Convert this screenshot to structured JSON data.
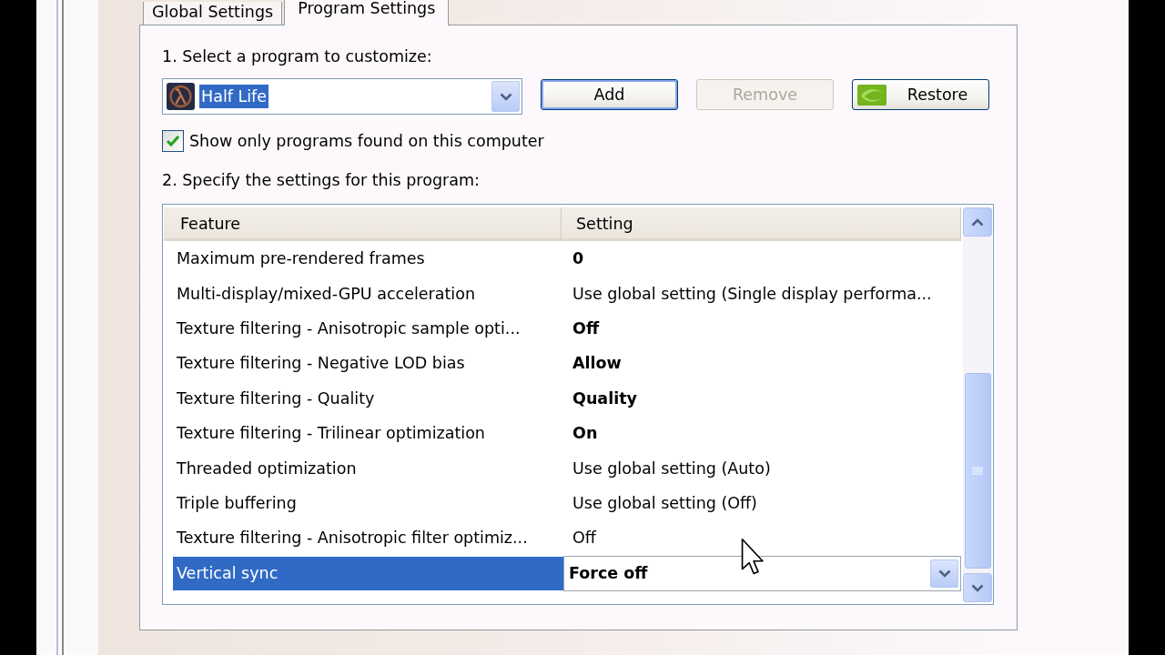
{
  "tabs": [
    {
      "label": "Global Settings",
      "selected": false
    },
    {
      "label": "Program Settings",
      "selected": true
    }
  ],
  "program_section": {
    "heading": "1. Select a program to customize:",
    "program_select": {
      "value": "Half Life",
      "focused": true
    },
    "buttons": [
      {
        "label": "Add",
        "kind": "text",
        "default": true,
        "disabled": false
      },
      {
        "label": "Remove",
        "kind": "text",
        "default": false,
        "disabled": true
      },
      {
        "label": "Restore",
        "kind": "logo",
        "default": false,
        "disabled": false
      }
    ],
    "checkbox": {
      "label": "Show only programs found on this computer",
      "checked": true
    }
  },
  "settings_section": {
    "heading": "2. Specify the settings for this program:",
    "table": {
      "columns": [
        "Feature",
        "Setting"
      ],
      "rows": [
        {
          "feature": "Maximum pre-rendered frames",
          "setting": "0",
          "overridden": true,
          "selected": false
        },
        {
          "feature": "Multi-display/mixed-GPU acceleration",
          "setting": "Use global setting (Single display performa...",
          "overridden": false,
          "selected": false
        },
        {
          "feature": "Texture filtering - Anisotropic sample opti...",
          "setting": "Off",
          "overridden": true,
          "selected": false
        },
        {
          "feature": "Texture filtering - Negative LOD bias",
          "setting": "Allow",
          "overridden": true,
          "selected": false
        },
        {
          "feature": "Texture filtering - Quality",
          "setting": "Quality",
          "overridden": true,
          "selected": false
        },
        {
          "feature": "Texture filtering - Trilinear optimization",
          "setting": "On",
          "overridden": true,
          "selected": false
        },
        {
          "feature": "Threaded optimization",
          "setting": "Use global setting (Auto)",
          "overridden": false,
          "selected": false
        },
        {
          "feature": "Triple buffering",
          "setting": "Use global setting (Off)",
          "overridden": false,
          "selected": false
        },
        {
          "feature": "Texture filtering - Anisotropic filter optimiz...",
          "setting": "Off",
          "overridden": false,
          "selected": false
        },
        {
          "feature": "Vertical sync",
          "setting": "Force off",
          "overridden": true,
          "selected": true
        }
      ]
    }
  }
}
